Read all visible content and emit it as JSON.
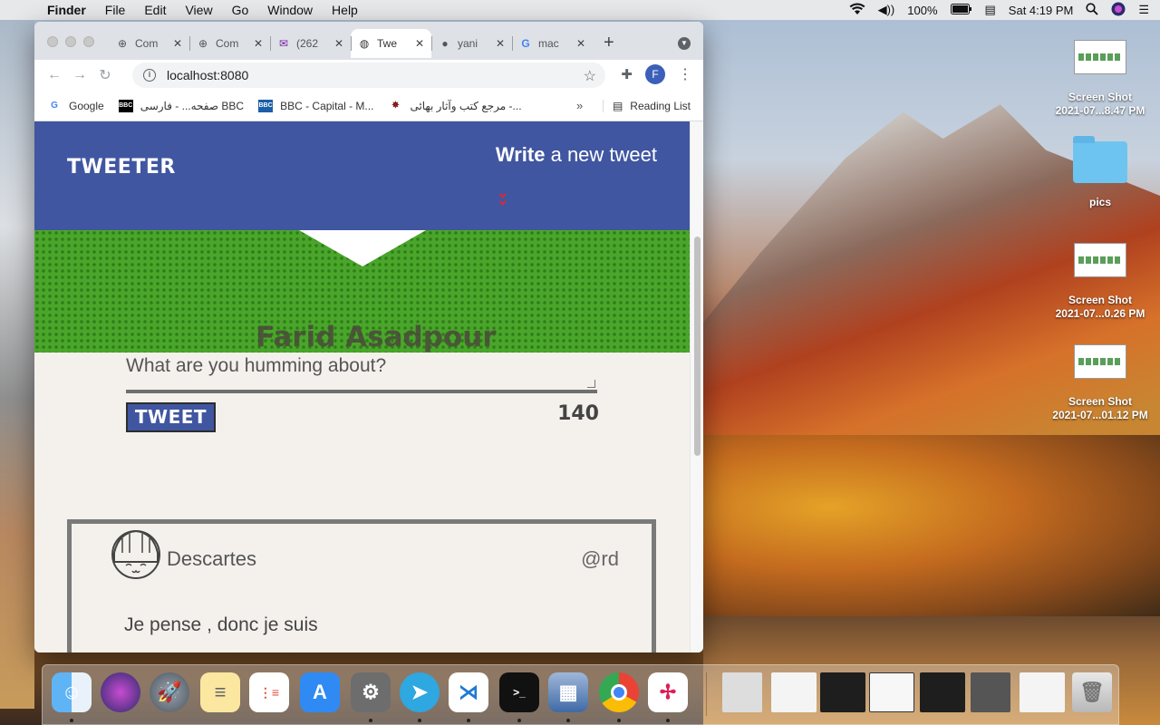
{
  "menubar": {
    "app_name": "Finder",
    "menus": [
      "File",
      "Edit",
      "View",
      "Go",
      "Window",
      "Help"
    ],
    "battery": "100%",
    "clock": "Sat 4:19 PM"
  },
  "browser": {
    "tabs": [
      {
        "label": "Com",
        "icon": "plus-circle-icon"
      },
      {
        "label": "Com",
        "icon": "plus-circle-icon"
      },
      {
        "label": "(262",
        "icon": "mail-icon"
      },
      {
        "label": "Twe",
        "icon": "globe-icon",
        "active": true
      },
      {
        "label": "yani",
        "icon": "github-icon"
      },
      {
        "label": "mac",
        "icon": "google-icon"
      }
    ],
    "url": "localhost:8080",
    "profile_initial": "F",
    "bookmarks": [
      {
        "label": "Google",
        "icon": "google-icon"
      },
      {
        "label": "صفحه... - فارسی BBC",
        "icon": "bbc-icon"
      },
      {
        "label": "BBC - Capital - M...",
        "icon": "bbc-capital-icon"
      },
      {
        "label": "مرجع کتب وآثار بهائی -...",
        "icon": "star-emblem-icon"
      }
    ],
    "reading_list": "Reading List"
  },
  "page": {
    "brand": "TWEETER",
    "compose_bold": "Write",
    "compose_rest": " a new tweet",
    "profile_name": "Farid Asadpour",
    "textarea_placeholder": "What are you humming about?",
    "tweet_button": "TWEET",
    "counter": "140",
    "tweet": {
      "name": "Descartes",
      "handle": "@rd",
      "content": "Je pense , donc je suis"
    },
    "colors": {
      "nav_bg": "#4056a1",
      "banner_green": "#4aa62b",
      "page_bg": "#f4f1ec",
      "chevron_red": "#e8242b"
    }
  },
  "desktop": {
    "icons": [
      {
        "label_line1": "Screen Shot",
        "label_line2": "2021-07...8.47 PM",
        "type": "screenshot"
      },
      {
        "label_line1": "pics",
        "label_line2": "",
        "type": "folder"
      },
      {
        "label_line1": "Screen Shot",
        "label_line2": "2021-07...0.26 PM",
        "type": "screenshot"
      },
      {
        "label_line1": "Screen Shot",
        "label_line2": "2021-07...01.12 PM",
        "type": "screenshot"
      }
    ]
  },
  "dock": {
    "apps": [
      "finder-icon",
      "siri-icon",
      "launchpad-icon",
      "notes-icon",
      "reminders-icon",
      "app-store-icon",
      "system-preferences-icon",
      "telegram-icon",
      "vscode-icon",
      "terminal-icon",
      "preview-icon",
      "chrome-icon",
      "slack-icon"
    ],
    "minimized": [
      "window-1",
      "window-2",
      "window-3",
      "window-4",
      "window-5",
      "window-6",
      "window-7"
    ],
    "trash": "trash-icon"
  }
}
